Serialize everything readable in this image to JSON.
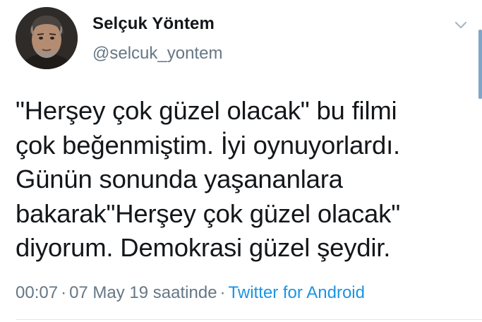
{
  "tweet": {
    "author": {
      "display_name": "Selçuk Yöntem",
      "handle": "@selcuk_yontem",
      "avatar_icon": "profile-photo"
    },
    "text": "\"Herşey çok güzel olacak\" bu filmi\nçok beğenmiştim. İyi oynuyorlardı.\nGünün sonunda yaşananlara\nbakarak\"Herşey çok güzel olacak\"\ndiyorum. Demokrasi güzel şeydir.",
    "time": "00:07",
    "date": "07 May 19 saatinde",
    "separator": "·",
    "source": "Twitter for Android",
    "menu_icon": "chevron-down-icon"
  },
  "colors": {
    "primary_text": "#14171a",
    "secondary_text": "#657786",
    "link": "#1b95e0",
    "divider": "#e1e8ed"
  }
}
